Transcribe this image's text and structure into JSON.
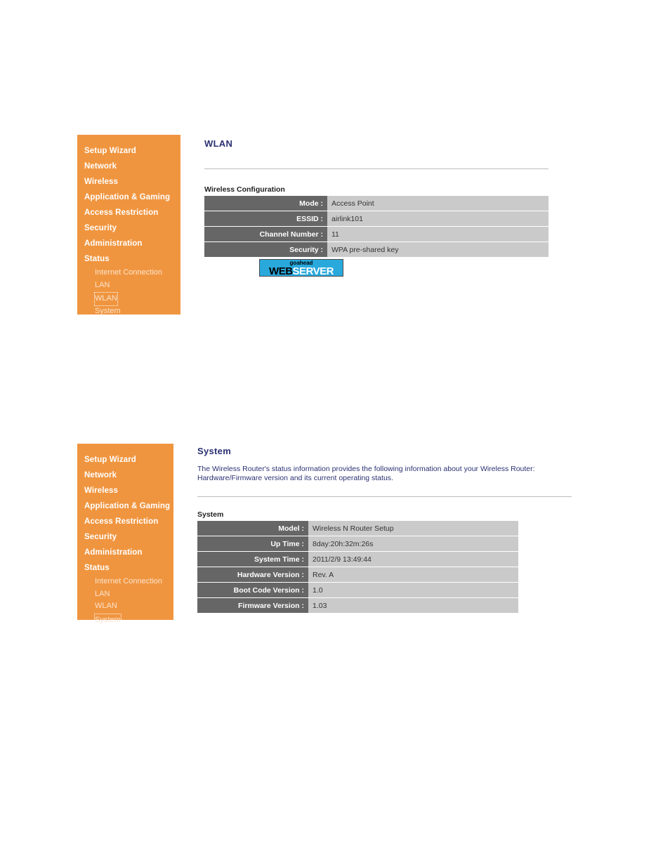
{
  "nav": {
    "main_items": [
      {
        "label": "Setup Wizard"
      },
      {
        "label": "Network"
      },
      {
        "label": "Wireless"
      },
      {
        "label": "Application & Gaming"
      },
      {
        "label": "Access Restriction"
      },
      {
        "label": "Security"
      },
      {
        "label": "Administration"
      },
      {
        "label": "Status"
      }
    ],
    "sub_items": [
      {
        "label": "Internet Connection"
      },
      {
        "label": "LAN"
      },
      {
        "label": "WLAN"
      },
      {
        "label": "System"
      }
    ],
    "selected_top": "WLAN",
    "selected_bottom": "System"
  },
  "wlan_page": {
    "title": "WLAN",
    "section_label": "Wireless Configuration",
    "rows": [
      {
        "key": "Mode :",
        "value": "Access Point"
      },
      {
        "key": "ESSID :",
        "value": "airlink101"
      },
      {
        "key": "Channel Number :",
        "value": "11"
      },
      {
        "key": "Security :",
        "value": "WPA pre-shared key"
      }
    ],
    "logo": {
      "top_text": "goahead",
      "left_text": "WEB",
      "right_text": "SERVER"
    }
  },
  "system_page": {
    "title": "System",
    "description": "The Wireless Router's status information provides the following information about your Wireless Router: Hardware/Firmware version and its current operating status.",
    "section_label": "System",
    "rows": [
      {
        "key": "Model :",
        "value": "Wireless N Router Setup"
      },
      {
        "key": "Up Time :",
        "value": "8day:20h:32m:26s"
      },
      {
        "key": "System Time :",
        "value": "2011/2/9 13:49:44"
      },
      {
        "key": "Hardware Version :",
        "value": "Rev. A"
      },
      {
        "key": "Boot Code Version :",
        "value": "1.0"
      },
      {
        "key": "Firmware Version :",
        "value": "1.03"
      }
    ]
  },
  "colors": {
    "sidebar_orange": "#F0953F",
    "table_key_gray": "#666666",
    "table_value_gray": "#CACACA",
    "title_blue": "#2B3172",
    "logo_blue": "#29A8DC"
  }
}
